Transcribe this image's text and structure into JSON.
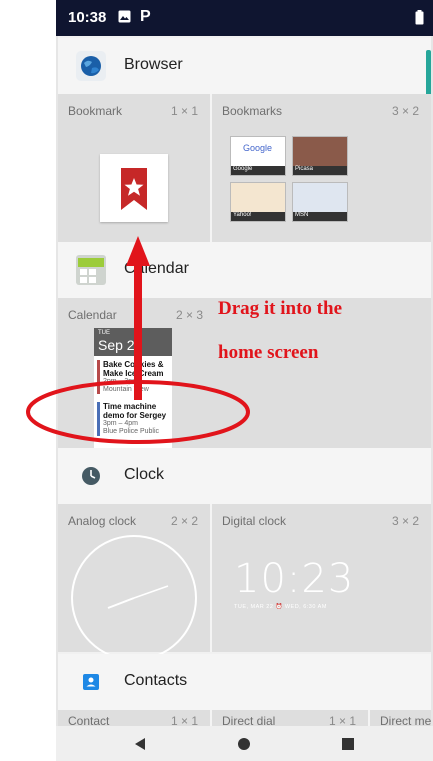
{
  "status": {
    "time": "10:38",
    "image_icon": "image-icon",
    "app_icon": "parking-icon",
    "battery_icon": "battery-icon"
  },
  "apps": [
    {
      "name": "Browser",
      "icon": "globe-icon"
    },
    {
      "name": "Calendar",
      "icon": "calendar-app-icon"
    },
    {
      "name": "Clock",
      "icon": "clock-app-icon"
    },
    {
      "name": "Contacts",
      "icon": "contacts-app-icon"
    }
  ],
  "browser_widgets": [
    {
      "name": "Bookmark",
      "size": "1 × 1"
    },
    {
      "name": "Bookmarks",
      "size": "3 × 2"
    }
  ],
  "bookmarks_preview": [
    "Google",
    "Picasa",
    "Yahoo!",
    "MSN"
  ],
  "calendar_widget": {
    "name": "Calendar",
    "size": "2 × 3",
    "weekday": "TUE",
    "date": "Sep 27",
    "events": [
      {
        "title": "Bake Cookies & Make Ice Cream",
        "time": "2pm – 3pm",
        "place": "Mountain View"
      },
      {
        "title": "Time machine demo for Sergey",
        "time": "3pm – 4pm",
        "place": "Blue Police Public"
      }
    ]
  },
  "clock_widgets": [
    {
      "name": "Analog clock",
      "size": "2 × 2"
    },
    {
      "name": "Digital clock",
      "size": "3 × 2",
      "time": "10:23",
      "date_line": "TUE, MAR 22  ⏰ WED, 6:30 AM"
    }
  ],
  "contacts_widgets": [
    {
      "name": "Contact",
      "size": "1 × 1"
    },
    {
      "name": "Direct dial",
      "size": "1 × 1"
    },
    {
      "name": "Direct me",
      "size": ""
    }
  ],
  "annotation": {
    "line1": "Drag it into the",
    "line2": "home screen",
    "color": "#e1141b"
  },
  "nav": {
    "back_icon": "back-icon",
    "home_icon": "home-icon",
    "recents_icon": "recents-icon"
  }
}
